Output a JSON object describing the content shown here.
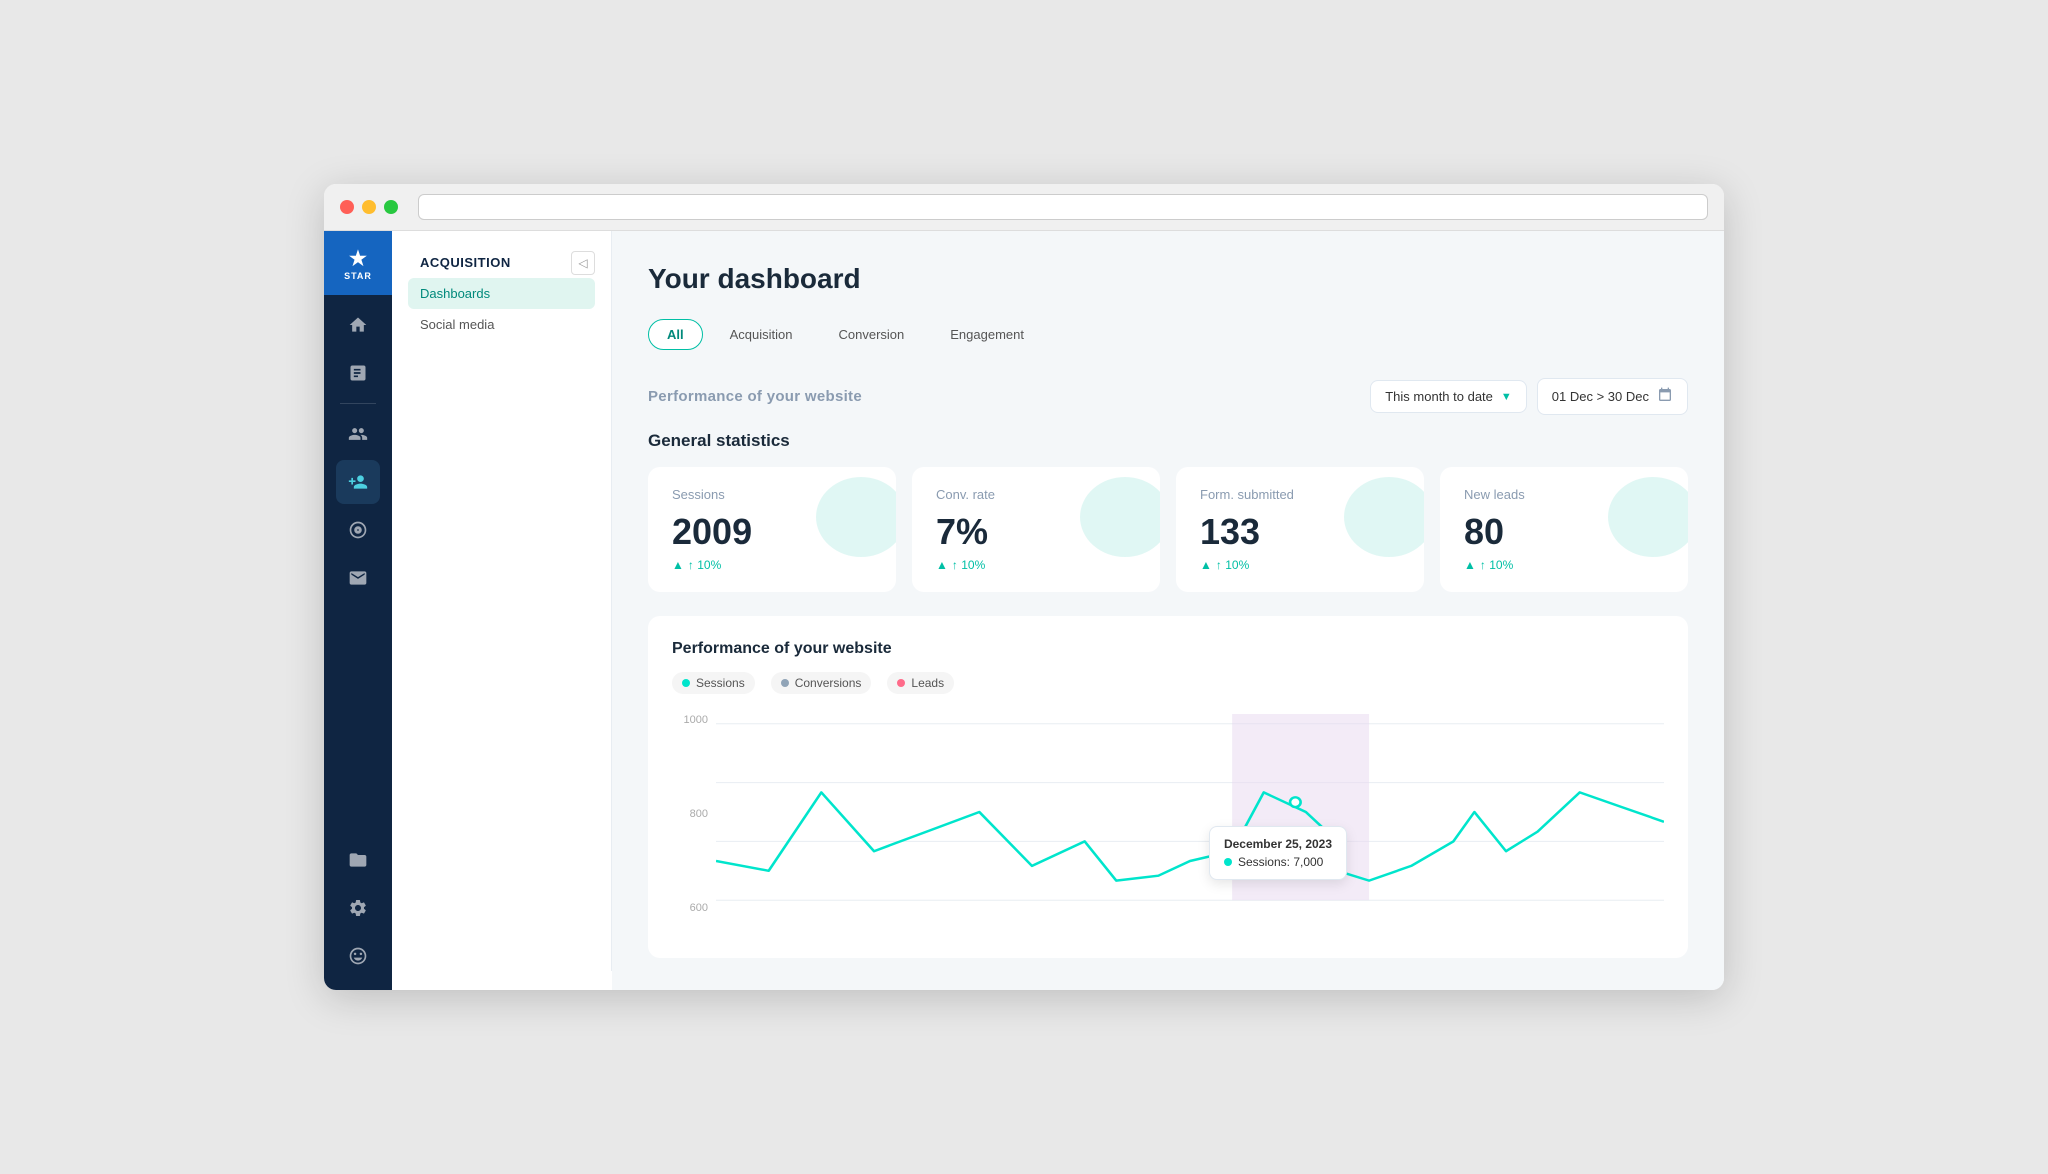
{
  "browser": {
    "dots": [
      "dot-red",
      "dot-yellow",
      "dot-green"
    ]
  },
  "icon_sidebar": {
    "logo_icon": "★",
    "logo_text": "STAR",
    "items": [
      {
        "name": "home-icon",
        "icon": "⌂",
        "active": false
      },
      {
        "name": "report-icon",
        "icon": "☰",
        "active": false
      },
      {
        "name": "people-icon",
        "icon": "👥",
        "active": false
      },
      {
        "name": "add-person-icon",
        "icon": "👤+",
        "active": true
      },
      {
        "name": "target-icon",
        "icon": "◎",
        "active": false
      },
      {
        "name": "mail-icon",
        "icon": "✉",
        "active": false
      },
      {
        "name": "folder-icon",
        "icon": "📁",
        "active": false
      },
      {
        "name": "settings-icon",
        "icon": "⚙",
        "active": false
      },
      {
        "name": "face-icon",
        "icon": "☺",
        "active": false
      }
    ]
  },
  "nav_sidebar": {
    "section_title": "ACQUISITION",
    "items": [
      {
        "label": "Dashboards",
        "active": true
      },
      {
        "label": "Social media",
        "active": false
      }
    ]
  },
  "page": {
    "title": "Your dashboard",
    "tabs": [
      {
        "label": "All",
        "active": true
      },
      {
        "label": "Acquisition",
        "active": false
      },
      {
        "label": "Conversion",
        "active": false
      },
      {
        "label": "Engagement",
        "active": false
      }
    ],
    "performance_section": {
      "title": "Performance of your website",
      "dropdown_label": "This month to date",
      "date_range": "01 Dec > 30 Dec"
    },
    "general_statistics": {
      "title": "General statistics",
      "cards": [
        {
          "label": "Sessions",
          "value": "2009",
          "change": "↑ 10%",
          "bg_color": "#00bfa5"
        },
        {
          "label": "Conv. rate",
          "value": "7%",
          "change": "↑ 10%",
          "bg_color": "#00bfa5"
        },
        {
          "label": "Form. submitted",
          "value": "133",
          "change": "↑ 10%",
          "bg_color": "#00bfa5"
        },
        {
          "label": "New leads",
          "value": "80",
          "change": "↑ 10%",
          "bg_color": "#00bfa5"
        }
      ]
    },
    "chart": {
      "title": "Performance of your website",
      "legend": [
        {
          "label": "Sessions",
          "color": "#00e5cc"
        },
        {
          "label": "Conversions",
          "color": "#90a4b7"
        },
        {
          "label": "Leads",
          "color": "#ff6b8a"
        }
      ],
      "y_labels": [
        "1000",
        "800",
        "600"
      ],
      "tooltip": {
        "date": "December 25, 2023",
        "label": "Sessions: 7,000"
      }
    }
  }
}
